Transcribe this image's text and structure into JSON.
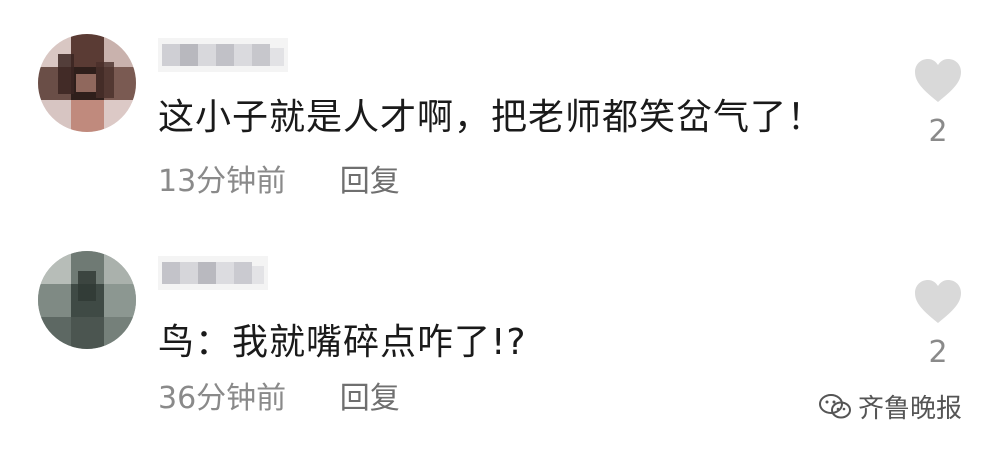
{
  "comments": [
    {
      "username_icon": "pixelated-username",
      "avatar_icon": "pixelated-avatar",
      "text": "这小子就是人才啊，把老师都笑岔气了！",
      "time": "13分钟前",
      "reply_label": "回复",
      "like_count": "2",
      "like_icon": "heart-icon"
    },
    {
      "username_icon": "pixelated-username",
      "avatar_icon": "pixelated-avatar",
      "text": "鸟：我就嘴碎点咋了!?",
      "time": "36分钟前",
      "reply_label": "回复",
      "like_count": "2",
      "like_icon": "heart-icon"
    }
  ],
  "watermark": {
    "icon": "wechat-icon",
    "text": "齐鲁晚报"
  },
  "colors": {
    "text": "#1a1a1a",
    "meta": "#8a8a8a",
    "heart": "#d9d9d9"
  }
}
